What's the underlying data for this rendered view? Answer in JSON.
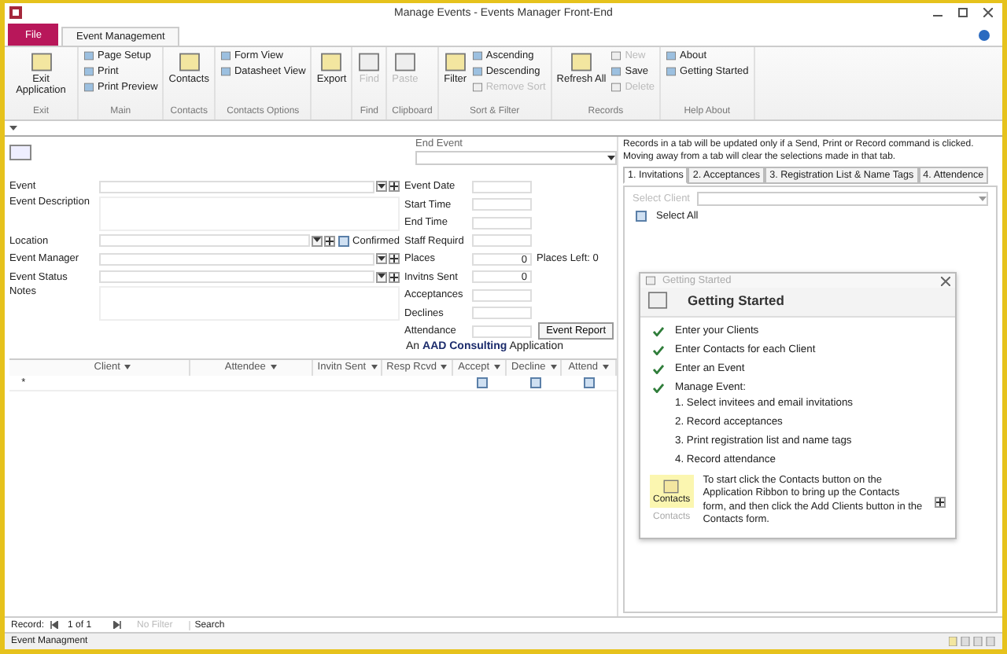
{
  "window": {
    "title": "Manage Events - Events Manager Front-End"
  },
  "ribbon_tabs": [
    {
      "label": "File",
      "kind": "file",
      "selected": false
    },
    {
      "label": "Event Management",
      "kind": "tab",
      "selected": true
    }
  ],
  "ribbon_groups": [
    {
      "label": "Exit",
      "items": [
        {
          "label": "Exit Application",
          "kind": "large",
          "disabled": false
        }
      ]
    },
    {
      "label": "Main",
      "items": [
        {
          "label": "Page Setup",
          "kind": "small",
          "disabled": false
        },
        {
          "label": "Print",
          "kind": "small",
          "disabled": false
        },
        {
          "label": "Print Preview",
          "kind": "small",
          "disabled": false
        }
      ]
    },
    {
      "label": "Contacts",
      "items": [
        {
          "label": "Contacts",
          "kind": "large",
          "disabled": false
        }
      ]
    },
    {
      "label": "Contacts Options",
      "items": [
        {
          "label": "Form View",
          "kind": "small",
          "disabled": false
        },
        {
          "label": "Datasheet View",
          "kind": "small",
          "disabled": false
        }
      ]
    },
    {
      "items": [
        {
          "label": "Export",
          "kind": "large",
          "disabled": false
        }
      ]
    },
    {
      "label": "Find",
      "items": [
        {
          "label": "Find",
          "kind": "large",
          "disabled": true
        }
      ]
    },
    {
      "label": "Clipboard",
      "items": [
        {
          "label": "Paste",
          "kind": "large",
          "disabled": true
        }
      ]
    },
    {
      "label": "Sort & Filter",
      "items": [
        {
          "label": "Filter",
          "kind": "large",
          "disabled": false
        },
        {
          "label": "Ascending",
          "kind": "small",
          "disabled": false
        },
        {
          "label": "Descending",
          "kind": "small",
          "disabled": false
        },
        {
          "label": "Remove Sort",
          "kind": "small",
          "disabled": true
        }
      ]
    },
    {
      "label": "Records",
      "items": [
        {
          "label": "Refresh All",
          "kind": "large",
          "disabled": false
        },
        {
          "label": "New",
          "kind": "small",
          "disabled": true
        },
        {
          "label": "Save",
          "kind": "small",
          "disabled": false
        },
        {
          "label": "Delete",
          "kind": "small",
          "disabled": true
        }
      ]
    },
    {
      "label": "Help About",
      "items": [
        {
          "label": "About",
          "kind": "small",
          "disabled": false
        },
        {
          "label": "Getting Started",
          "kind": "small",
          "disabled": false
        }
      ]
    }
  ],
  "form": {
    "end_event": {
      "label": "End Event"
    },
    "left_fields": [
      {
        "label": "Event",
        "kind": "combo",
        "add": true
      },
      {
        "label": "Event Description",
        "kind": "memo",
        "add": false
      },
      {
        "label": "Location",
        "kind": "combo",
        "add": true,
        "checkbox": {
          "label": "Confirmed",
          "checked": false
        }
      },
      {
        "label": "Event Manager",
        "kind": "combo",
        "add": true
      },
      {
        "label": "Event Status",
        "kind": "combo",
        "add": true
      },
      {
        "label": "Notes",
        "kind": "memo",
        "add": false
      }
    ],
    "right_fields": [
      {
        "label": "Event Date",
        "kind": "text"
      },
      {
        "label": "Start Time",
        "kind": "text"
      },
      {
        "label": "End Time",
        "kind": "text"
      },
      {
        "label": "Staff Requird",
        "kind": "text"
      },
      {
        "label": "Places",
        "kind": "number",
        "value": "0",
        "extra": "Places Left: 0"
      },
      {
        "label": "Invitns Sent",
        "kind": "number",
        "value": "0"
      },
      {
        "label": "Acceptances",
        "kind": "text"
      },
      {
        "label": "Declines",
        "kind": "text"
      },
      {
        "label": "Attendance",
        "kind": "text",
        "button": "Event Report"
      }
    ],
    "credit": "An **AAD Consulting** Application",
    "subform": {
      "columns": [
        {
          "label": "Client",
          "kind": "text"
        },
        {
          "label": "Attendee",
          "kind": "text"
        },
        {
          "label": "Invitn Sent",
          "kind": "text"
        },
        {
          "label": "Resp Rcvd",
          "kind": "text"
        },
        {
          "label": "Accept",
          "kind": "check",
          "checked": false
        },
        {
          "label": "Decline",
          "kind": "check",
          "checked": false
        },
        {
          "label": "Attend",
          "kind": "check",
          "checked": false
        }
      ],
      "new_row_marker": "*"
    }
  },
  "panel": {
    "notice": "Records in a tab will be updated only if a Send, Print or Record command is clicked.   Moving away from a tab will clear the selections made in that tab.",
    "tabs": [
      {
        "label": "1. Invitations",
        "selected": true
      },
      {
        "label": "2. Acceptances",
        "selected": false
      },
      {
        "label": "3. Registration List & Name Tags",
        "selected": false
      },
      {
        "label": "4. Attendence",
        "selected": false
      }
    ],
    "select_client": {
      "label": "Select Client",
      "disabled": true
    },
    "select_all": {
      "label": "Select All",
      "checked": false
    }
  },
  "getting_started": {
    "caption": "Getting Started",
    "heading": "Getting Started",
    "steps": [
      {
        "label": "Enter your Clients",
        "done": true
      },
      {
        "label": "Enter Contacts for each Client",
        "done": true
      },
      {
        "label": "Enter an Event",
        "done": true
      },
      {
        "label": "Manage Event:",
        "done": true
      }
    ],
    "substeps": [
      "1. Select invitees and email invitations",
      "2. Record acceptances",
      "3. Print registration list and name tags",
      "4. Record attendance"
    ],
    "button": {
      "label": "Contacts",
      "caption": "Contacts"
    },
    "instructions": "To start click  the Contacts button on the Application Ribbon to bring up the Contacts form, and then click the Add Clients button in the Contacts form."
  },
  "record_nav": {
    "label": "Record:",
    "position": "1 of 1",
    "filter": "No Filter",
    "search": "Search"
  },
  "status_bar": {
    "text": "Event Managment"
  }
}
